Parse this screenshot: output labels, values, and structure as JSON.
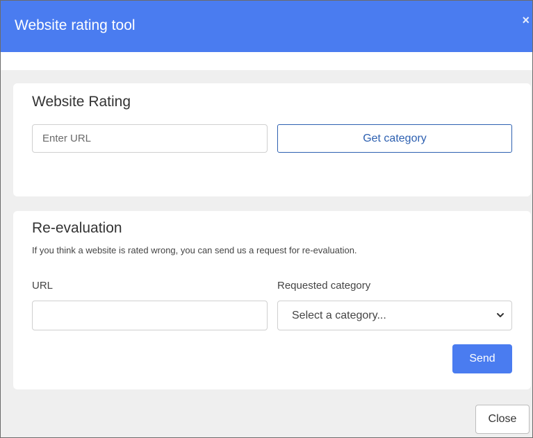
{
  "dialog": {
    "title": "Website rating tool",
    "close_glyph": "×"
  },
  "rating": {
    "heading": "Website Rating",
    "url_placeholder": "Enter URL",
    "get_category_label": "Get category"
  },
  "reevaluation": {
    "heading": "Re-evaluation",
    "description": "If you think a website is rated wrong, you can send us a request for re-evaluation.",
    "url_label": "URL",
    "url_value": "",
    "category_label": "Requested category",
    "category_selected": "Select a category...",
    "send_label": "Send"
  },
  "footer": {
    "close_label": "Close"
  },
  "colors": {
    "title_bar": "#4a7cf0",
    "primary_button": "#4a7cf0",
    "outline_button": "#2c5fb0",
    "body_bg": "#efefef"
  }
}
